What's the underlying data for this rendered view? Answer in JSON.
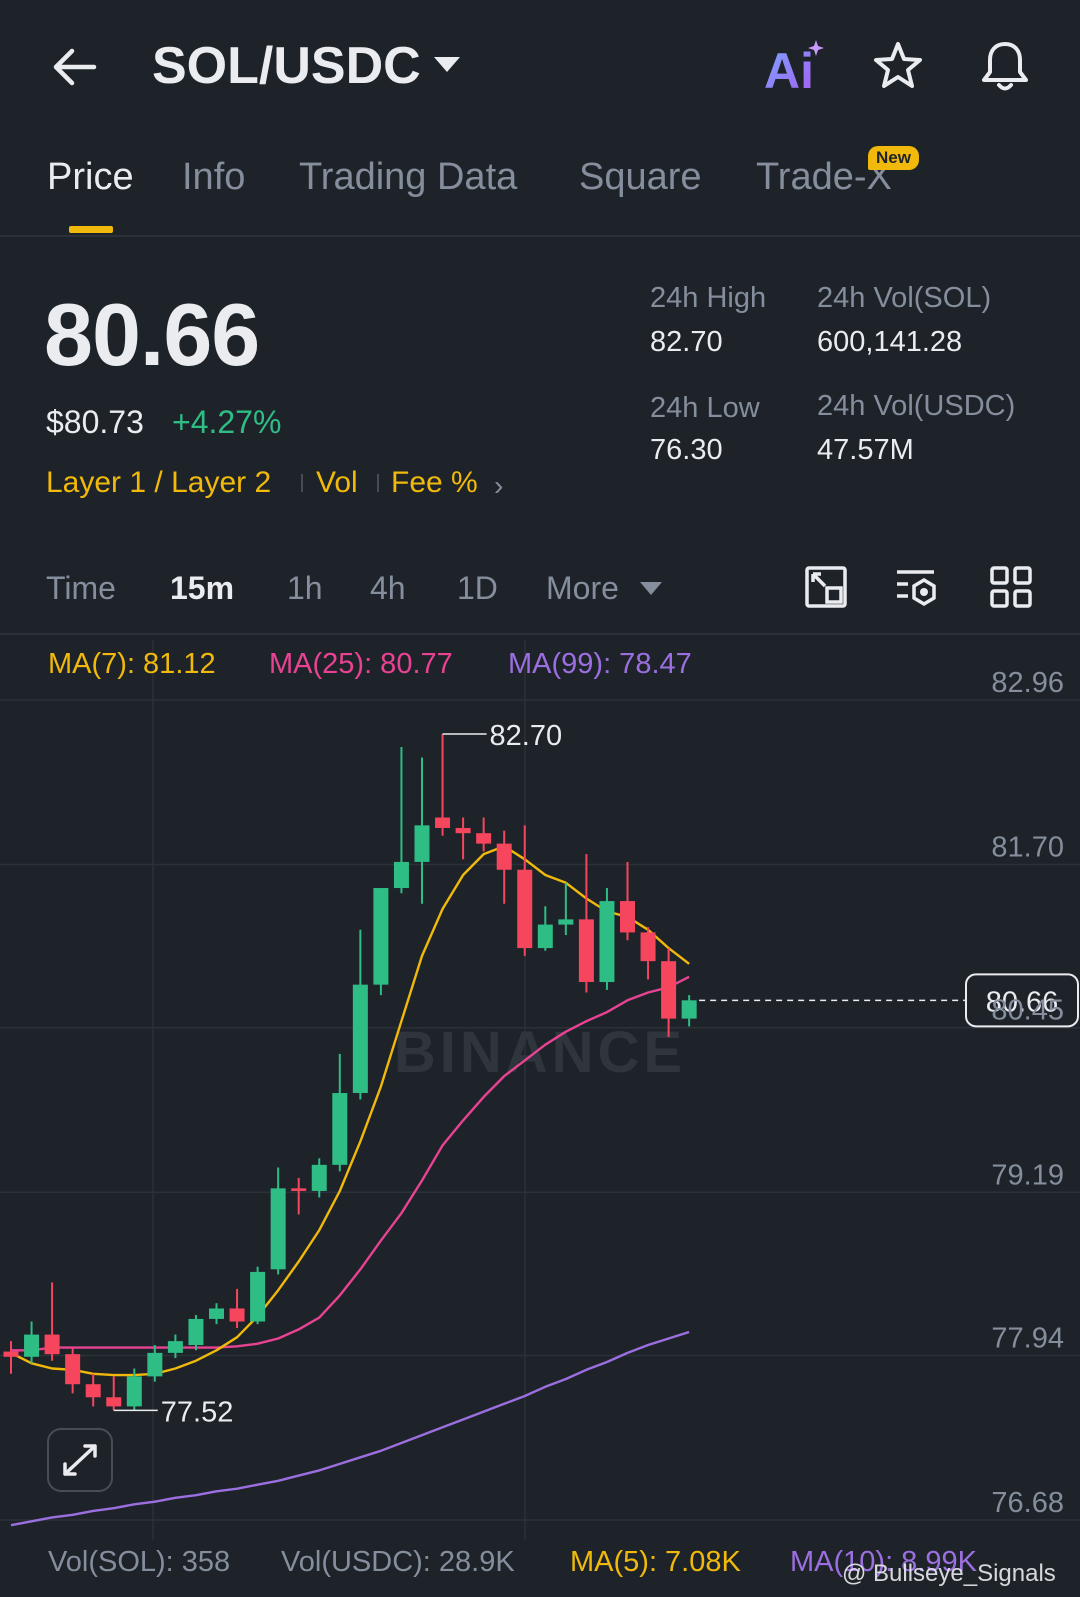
{
  "header": {
    "pair": "SOL/USDC",
    "icons": [
      "back-arrow-icon",
      "chevron-down-icon",
      "ai-icon",
      "star-icon",
      "bell-icon"
    ],
    "ai_label": "Ai"
  },
  "tabs": [
    {
      "label": "Price",
      "active": true
    },
    {
      "label": "Info"
    },
    {
      "label": "Trading Data"
    },
    {
      "label": "Square"
    },
    {
      "label": "Trade-X",
      "badge": "New"
    }
  ],
  "price": {
    "last": "80.66",
    "usd": "$80.73",
    "change": "+4.27%",
    "tags": [
      "Layer 1 / Layer 2",
      "Vol",
      "Fee %"
    ]
  },
  "stats": {
    "high_label": "24h High",
    "high_value": "82.70",
    "low_label": "24h Low",
    "low_value": "76.30",
    "vol_sol_label": "24h Vol(SOL)",
    "vol_sol_value": "600,141.28",
    "vol_usdc_label": "24h Vol(USDC)",
    "vol_usdc_value": "47.57M"
  },
  "intervals": {
    "items": [
      "Time",
      "15m",
      "1h",
      "4h",
      "1D",
      "More"
    ],
    "active": "15m",
    "tool_icons": [
      "chart-settings-icon",
      "indicator-settings-icon",
      "grid-layout-icon"
    ]
  },
  "ma_legend": {
    "ma7": "MA(7): 81.12",
    "ma25": "MA(25): 80.77",
    "ma99": "MA(99): 78.47"
  },
  "colors": {
    "up": "#2ebd85",
    "down": "#f6465d",
    "ma7": "#f0b90b",
    "ma25": "#e84393",
    "ma99": "#9b6fe0",
    "accent": "#f0b90b",
    "background": "#1e2329"
  },
  "chart_data": {
    "type": "candlestick",
    "interval": "15m",
    "y_axis_ticks": [
      "82.96",
      "81.70",
      "80.45",
      "79.19",
      "77.94",
      "76.68"
    ],
    "ylim": [
      76.68,
      82.96
    ],
    "current_price_label": "80.66",
    "high_marker": "82.70",
    "low_marker": "77.52",
    "watermark": "BINANCE",
    "candles": [
      {
        "o": 77.97,
        "h": 78.05,
        "l": 77.8,
        "c": 77.93
      },
      {
        "o": 77.93,
        "h": 78.2,
        "l": 77.88,
        "c": 78.1
      },
      {
        "o": 78.1,
        "h": 78.5,
        "l": 77.9,
        "c": 77.95
      },
      {
        "o": 77.95,
        "h": 78.0,
        "l": 77.65,
        "c": 77.72
      },
      {
        "o": 77.72,
        "h": 77.8,
        "l": 77.55,
        "c": 77.62
      },
      {
        "o": 77.62,
        "h": 77.78,
        "l": 77.52,
        "c": 77.55
      },
      {
        "o": 77.55,
        "h": 77.84,
        "l": 77.52,
        "c": 77.78
      },
      {
        "o": 77.78,
        "h": 78.02,
        "l": 77.74,
        "c": 77.96
      },
      {
        "o": 77.96,
        "h": 78.1,
        "l": 77.92,
        "c": 78.05
      },
      {
        "o": 78.02,
        "h": 78.25,
        "l": 77.98,
        "c": 78.22
      },
      {
        "o": 78.22,
        "h": 78.34,
        "l": 78.18,
        "c": 78.3
      },
      {
        "o": 78.3,
        "h": 78.45,
        "l": 78.15,
        "c": 78.2
      },
      {
        "o": 78.2,
        "h": 78.62,
        "l": 78.18,
        "c": 78.58
      },
      {
        "o": 78.6,
        "h": 79.38,
        "l": 78.56,
        "c": 79.22
      },
      {
        "o": 79.22,
        "h": 79.3,
        "l": 79.02,
        "c": 79.2
      },
      {
        "o": 79.2,
        "h": 79.45,
        "l": 79.15,
        "c": 79.4
      },
      {
        "o": 79.4,
        "h": 80.25,
        "l": 79.35,
        "c": 79.95
      },
      {
        "o": 79.95,
        "h": 81.2,
        "l": 79.9,
        "c": 80.78
      },
      {
        "o": 80.78,
        "h": 81.47,
        "l": 80.7,
        "c": 81.52
      },
      {
        "o": 81.52,
        "h": 82.6,
        "l": 81.48,
        "c": 81.72
      },
      {
        "o": 81.72,
        "h": 82.52,
        "l": 81.4,
        "c": 82.0
      },
      {
        "o": 82.06,
        "h": 82.7,
        "l": 81.92,
        "c": 81.98
      },
      {
        "o": 81.98,
        "h": 82.06,
        "l": 81.74,
        "c": 81.94
      },
      {
        "o": 81.94,
        "h": 82.06,
        "l": 81.8,
        "c": 81.86
      },
      {
        "o": 81.86,
        "h": 81.96,
        "l": 81.4,
        "c": 81.66
      },
      {
        "o": 81.66,
        "h": 82.0,
        "l": 81.0,
        "c": 81.06
      },
      {
        "o": 81.06,
        "h": 81.38,
        "l": 81.04,
        "c": 81.24
      },
      {
        "o": 81.24,
        "h": 81.56,
        "l": 81.16,
        "c": 81.28
      },
      {
        "o": 81.28,
        "h": 81.78,
        "l": 80.72,
        "c": 80.8
      },
      {
        "o": 80.8,
        "h": 81.52,
        "l": 80.74,
        "c": 81.42
      },
      {
        "o": 81.42,
        "h": 81.72,
        "l": 81.12,
        "c": 81.18
      },
      {
        "o": 81.18,
        "h": 81.22,
        "l": 80.82,
        "c": 80.96
      },
      {
        "o": 80.96,
        "h": 81.06,
        "l": 80.38,
        "c": 80.52
      },
      {
        "o": 80.52,
        "h": 80.7,
        "l": 80.46,
        "c": 80.66
      }
    ],
    "ma7_line": [
      77.96,
      77.88,
      77.84,
      77.83,
      77.8,
      77.79,
      77.79,
      77.8,
      77.84,
      77.9,
      77.98,
      78.08,
      78.24,
      78.44,
      78.66,
      78.9,
      79.2,
      79.58,
      80.0,
      80.5,
      81.0,
      81.36,
      81.62,
      81.78,
      81.84,
      81.74,
      81.62,
      81.56,
      81.44,
      81.34,
      81.3,
      81.2,
      81.06,
      80.94
    ],
    "ma25_line": [
      77.98,
      77.98,
      78.0,
      78.0,
      78.0,
      78.0,
      78.0,
      78.0,
      78.0,
      78.0,
      78.0,
      78.01,
      78.03,
      78.07,
      78.14,
      78.23,
      78.4,
      78.6,
      78.82,
      79.03,
      79.28,
      79.55,
      79.74,
      79.92,
      80.08,
      80.2,
      80.32,
      80.42,
      80.5,
      80.57,
      80.66,
      80.72,
      80.76,
      80.84
    ],
    "ma99_line": [
      76.64,
      76.67,
      76.7,
      76.72,
      76.75,
      76.77,
      76.8,
      76.82,
      76.85,
      76.87,
      76.9,
      76.92,
      76.95,
      76.98,
      77.02,
      77.06,
      77.11,
      77.16,
      77.21,
      77.27,
      77.33,
      77.39,
      77.45,
      77.51,
      77.57,
      77.63,
      77.7,
      77.76,
      77.83,
      77.89,
      77.96,
      78.02,
      78.07,
      78.12
    ]
  },
  "volume_legend": {
    "vol_sol": "Vol(SOL): 358",
    "vol_usdc": "Vol(USDC): 28.9K",
    "ma5": "MA(5): 7.08K",
    "ma10": "MA(10): 8.99K"
  },
  "credit": "@ Bullseye_Signals"
}
